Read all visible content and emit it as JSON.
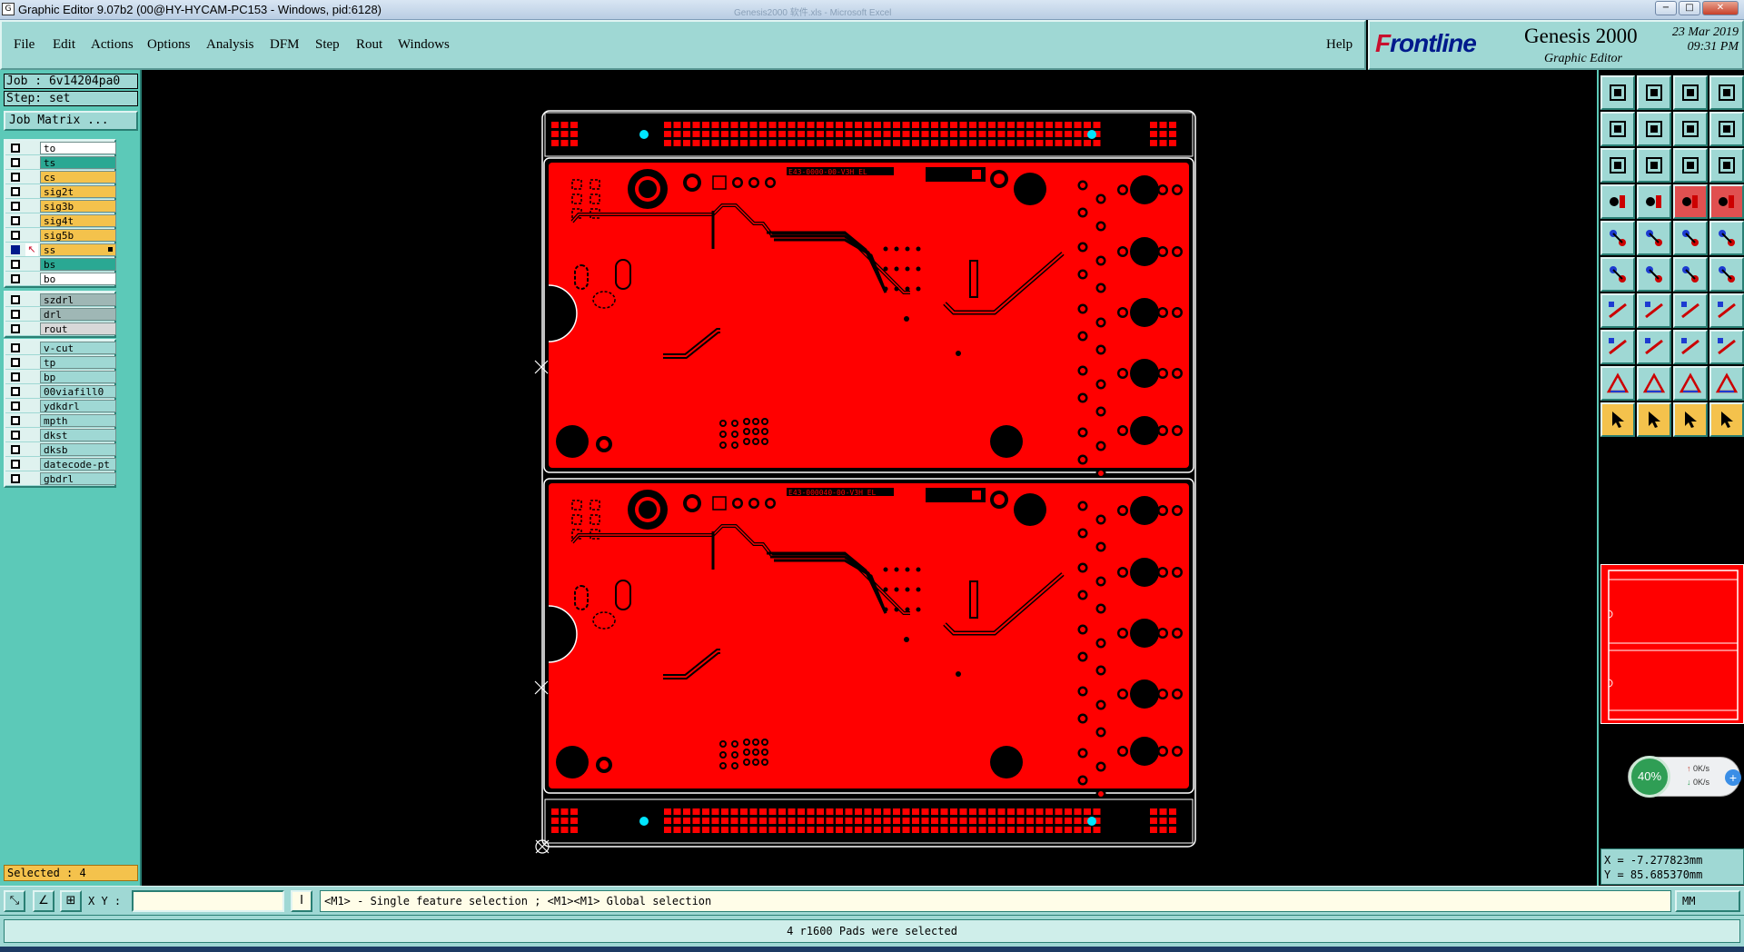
{
  "window": {
    "title": "Graphic Editor 9.07b2 (00@HY-HYCAM-PC153 - Windows, pid:6128)",
    "faded_text": "Genesis2000 软件.xls  -  Microsoft Excel",
    "buttons": {
      "minimize": "−",
      "maximize": "□",
      "close": "✕"
    }
  },
  "menu": {
    "items": [
      "File",
      "Edit",
      "Actions",
      "Options",
      "Analysis",
      "DFM",
      "Step",
      "Rout",
      "Windows"
    ],
    "help": "Help"
  },
  "brand": {
    "logo_prefix": "F",
    "logo_rest": "rontline",
    "product": "Genesis 2000",
    "subtitle": "Graphic Editor",
    "date": "23 Mar 2019",
    "time": "09:31 PM"
  },
  "job": {
    "job_label": "Job : 6v14204pa0",
    "step_label": "Step: set",
    "matrix_button": "Job Matrix ..."
  },
  "layers": {
    "board": [
      {
        "name": "to",
        "color": "#ffffff",
        "active": false
      },
      {
        "name": "ts",
        "color": "#2aa893",
        "active": false
      },
      {
        "name": "cs",
        "color": "#f4c24c",
        "active": false
      },
      {
        "name": "sig2t",
        "color": "#f4c24c",
        "active": false
      },
      {
        "name": "sig3b",
        "color": "#f4c24c",
        "active": false
      },
      {
        "name": "sig4t",
        "color": "#f4c24c",
        "active": false
      },
      {
        "name": "sig5b",
        "color": "#f4c24c",
        "active": false
      },
      {
        "name": "ss",
        "color": "#f4c24c",
        "active": true
      },
      {
        "name": "bs",
        "color": "#2aa893",
        "active": false
      },
      {
        "name": "bo",
        "color": "#ffffff",
        "active": false
      }
    ],
    "drill": [
      {
        "name": "szdrl",
        "color": "#9fb7b5"
      },
      {
        "name": "drl",
        "color": "#9fb7b5"
      },
      {
        "name": "rout",
        "color": "#d8d8d8"
      }
    ],
    "misc": [
      {
        "name": "v-cut"
      },
      {
        "name": "tp"
      },
      {
        "name": "bp"
      },
      {
        "name": "00viafill0"
      },
      {
        "name": "ydkdrl"
      },
      {
        "name": "mpth"
      },
      {
        "name": "dkst"
      },
      {
        "name": "dksb"
      },
      {
        "name": "datecode-pt"
      },
      {
        "name": "gbdrl"
      }
    ]
  },
  "selected_label": "Selected : 4",
  "pcb_labels": [
    "E43-0000-00-V3H EL",
    "E43-000040-00-V3H EL"
  ],
  "colors": {
    "copper": "#ff0000",
    "panel_bg": "#9fd8d4",
    "layer_panel": "#5cc9b8",
    "outline": "#ffffff",
    "fiducial": "#00e5ff"
  },
  "network": {
    "percent": "40%",
    "up": "0K/s",
    "down": "0K/s"
  },
  "coordinates": {
    "x": "X = -7.277823mm",
    "y": "Y = 85.685370mm"
  },
  "xy_input": {
    "label": "X Y :",
    "value": ""
  },
  "hint": "<M1> - Single feature selection ; <M1><M1> Global selection",
  "units": "MM",
  "status_message": "4 r1600 Pads were selected"
}
